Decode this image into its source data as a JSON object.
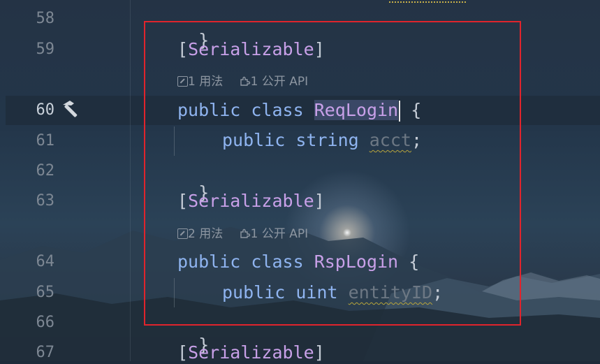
{
  "colors": {
    "keyword": "#8fb4f0",
    "class_name": "#c8a0e8",
    "line_number": "#7d8793",
    "selection_border": "#e0242c",
    "hint_text": "#8d96a1"
  },
  "gutter": {
    "lines": [
      "58",
      "59",
      "60",
      "61",
      "62",
      "63",
      "64",
      "65",
      "66",
      "67"
    ]
  },
  "code": {
    "l58": "}",
    "l59": {
      "open": "[",
      "attr": "Serializable",
      "close": "]"
    },
    "hint1": {
      "usages": "1 用法",
      "api": "1 公开 API"
    },
    "l60": {
      "kw1": "public",
      "kw2": "class",
      "name": "ReqLogin",
      "brace": "{"
    },
    "l61": {
      "kw1": "public",
      "kw2": "string",
      "field": "acct",
      "semi": ";"
    },
    "l62": "}",
    "l63": {
      "open": "[",
      "attr": "Serializable",
      "close": "]"
    },
    "hint2": {
      "usages": "2 用法",
      "api": "1 公开 API"
    },
    "l64": {
      "kw1": "public",
      "kw2": "class",
      "name": "RspLogin",
      "brace": "{"
    },
    "l65": {
      "kw1": "public",
      "kw2": "uint",
      "field": "entityID",
      "semi": ";"
    },
    "l66": "}",
    "l67": {
      "open": "[",
      "attr": "Serializable",
      "close": "]"
    }
  },
  "icons": {
    "run_gutter": "hammer-icon",
    "usages": "usages-icon",
    "api": "puzzle-icon"
  }
}
